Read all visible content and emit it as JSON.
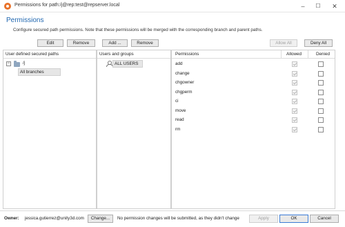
{
  "window": {
    "title": "Permissions for path:/j@rep:test@repserver.local",
    "min_glyph": "–",
    "max_glyph": "☐",
    "close_glyph": "✕"
  },
  "header": {
    "title": "Permissions",
    "description": "Configure secured path permissions. Note that these permissions will be merged with the corresponding branch and parent paths."
  },
  "paths_toolbar": {
    "edit_label": "Edit",
    "remove_label": "Remove"
  },
  "users_toolbar": {
    "add_label": "Add ...",
    "remove_label": "Remove"
  },
  "perm_toolbar": {
    "allow_all_label": "Allow All",
    "deny_all_label": "Deny All"
  },
  "paths_panel": {
    "header": "User defined secured paths",
    "collapse_glyph": "−",
    "path": "/j",
    "selected_item": "All branches"
  },
  "users_panel": {
    "header": "Users and groups",
    "users": [
      "ALL USERS"
    ]
  },
  "permissions_panel": {
    "col_permissions": "Permissions",
    "col_allowed": "Allowed",
    "col_denied": "Denied",
    "rows": [
      {
        "name": "add",
        "allowed": true,
        "denied": false
      },
      {
        "name": "change",
        "allowed": true,
        "denied": false
      },
      {
        "name": "chgowner",
        "allowed": true,
        "denied": false
      },
      {
        "name": "chgperm",
        "allowed": true,
        "denied": false
      },
      {
        "name": "ci",
        "allowed": true,
        "denied": false
      },
      {
        "name": "move",
        "allowed": true,
        "denied": false
      },
      {
        "name": "read",
        "allowed": true,
        "denied": false
      },
      {
        "name": "rm",
        "allowed": true,
        "denied": false
      }
    ]
  },
  "footer": {
    "owner_label": "Owner:",
    "owner_value": "jessica.gutierrez@unity3d.com",
    "change_label": "Change...",
    "status": "No permission changes will be submitted, as they didn't change",
    "apply_label": "Apply",
    "ok_label": "OK",
    "cancel_label": "Cancel"
  }
}
